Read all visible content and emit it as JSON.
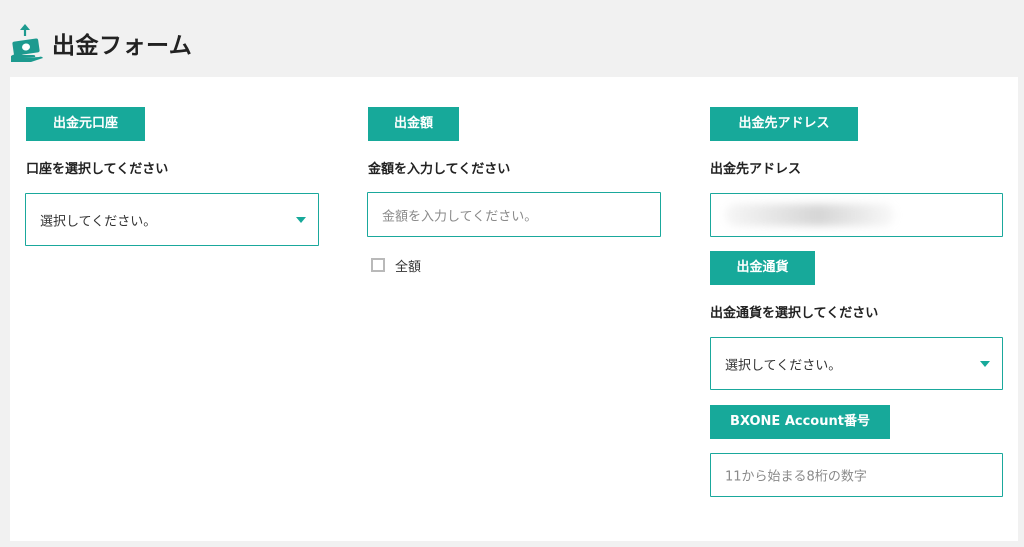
{
  "header": {
    "title": "出金フォーム",
    "icon": "withdraw-money-icon"
  },
  "colors": {
    "accent": "#17a99a",
    "border": "#1aa89c",
    "background": "#f1f1f1"
  },
  "source_account": {
    "tag": "出金元口座",
    "label": "口座を選択してください",
    "select_value": "選択してください。"
  },
  "amount": {
    "tag": "出金額",
    "label": "金額を入力してください",
    "placeholder": "金額を入力してください。",
    "full_amount_label": "全額"
  },
  "destination": {
    "tag": "出金先アドレス",
    "label": "出金先アドレス"
  },
  "currency": {
    "tag": "出金通貨",
    "label": "出金通貨を選択してください",
    "select_value": "選択してください。"
  },
  "bxone": {
    "tag": "BXONE Account番号",
    "placeholder": "11から始まる8桁の数字"
  }
}
